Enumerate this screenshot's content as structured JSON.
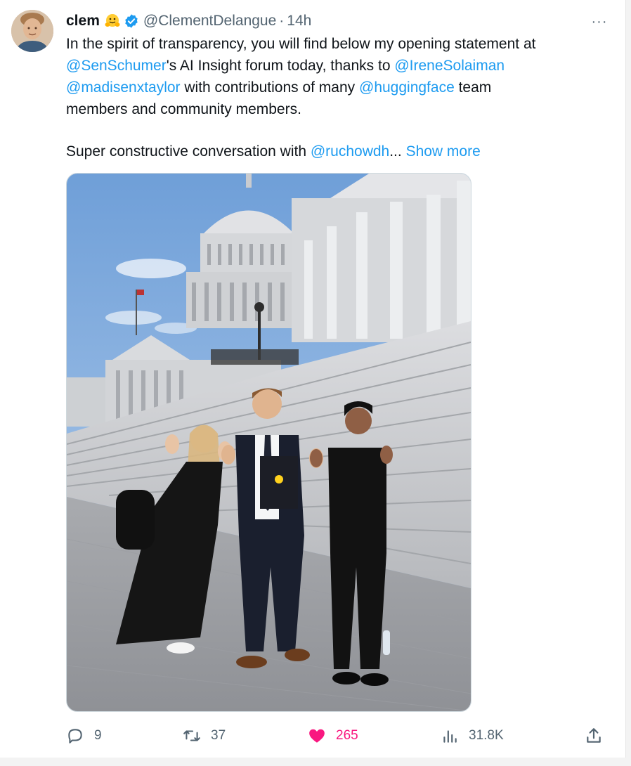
{
  "tweet": {
    "author_name": "clem",
    "author_emoji": "hugging-face-emoji",
    "verified_icon": "verified-badge-icon",
    "handle": "@ClementDelangue",
    "separator": "·",
    "time": "14h",
    "more_icon": "more-icon",
    "more_label": "···",
    "text": {
      "l1": "In the spirit of transparency, you will find below my opening statement at",
      "l2_mention1": "@SenSchumer",
      "l2_mid": "'s AI Insight forum today, thanks to ",
      "l2_mention2": "@IreneSolaiman",
      "l3_mention1": "@madisenxtaylor",
      "l3_mid": " with contributions of many ",
      "l3_mention2": "@huggingface",
      "l3_end": " team",
      "l4": "members and community members.",
      "l5_start": "Super constructive conversation with ",
      "l5_mention": "@ruchowdh",
      "l5_ellipsis": "... ",
      "show_more": "Show more"
    },
    "photo_icon": "photo"
  },
  "actions": {
    "replies": "9",
    "reposts": "37",
    "likes": "265",
    "views": "31.8K",
    "reply_icon": "reply-icon",
    "repost_icon": "repost-icon",
    "like_icon": "heart-icon",
    "views_icon": "views-icon",
    "share_icon": "share-icon"
  },
  "colors": {
    "link": "#1d9bf0",
    "like": "#f91880",
    "muted": "#536471",
    "text": "#0f1419"
  }
}
